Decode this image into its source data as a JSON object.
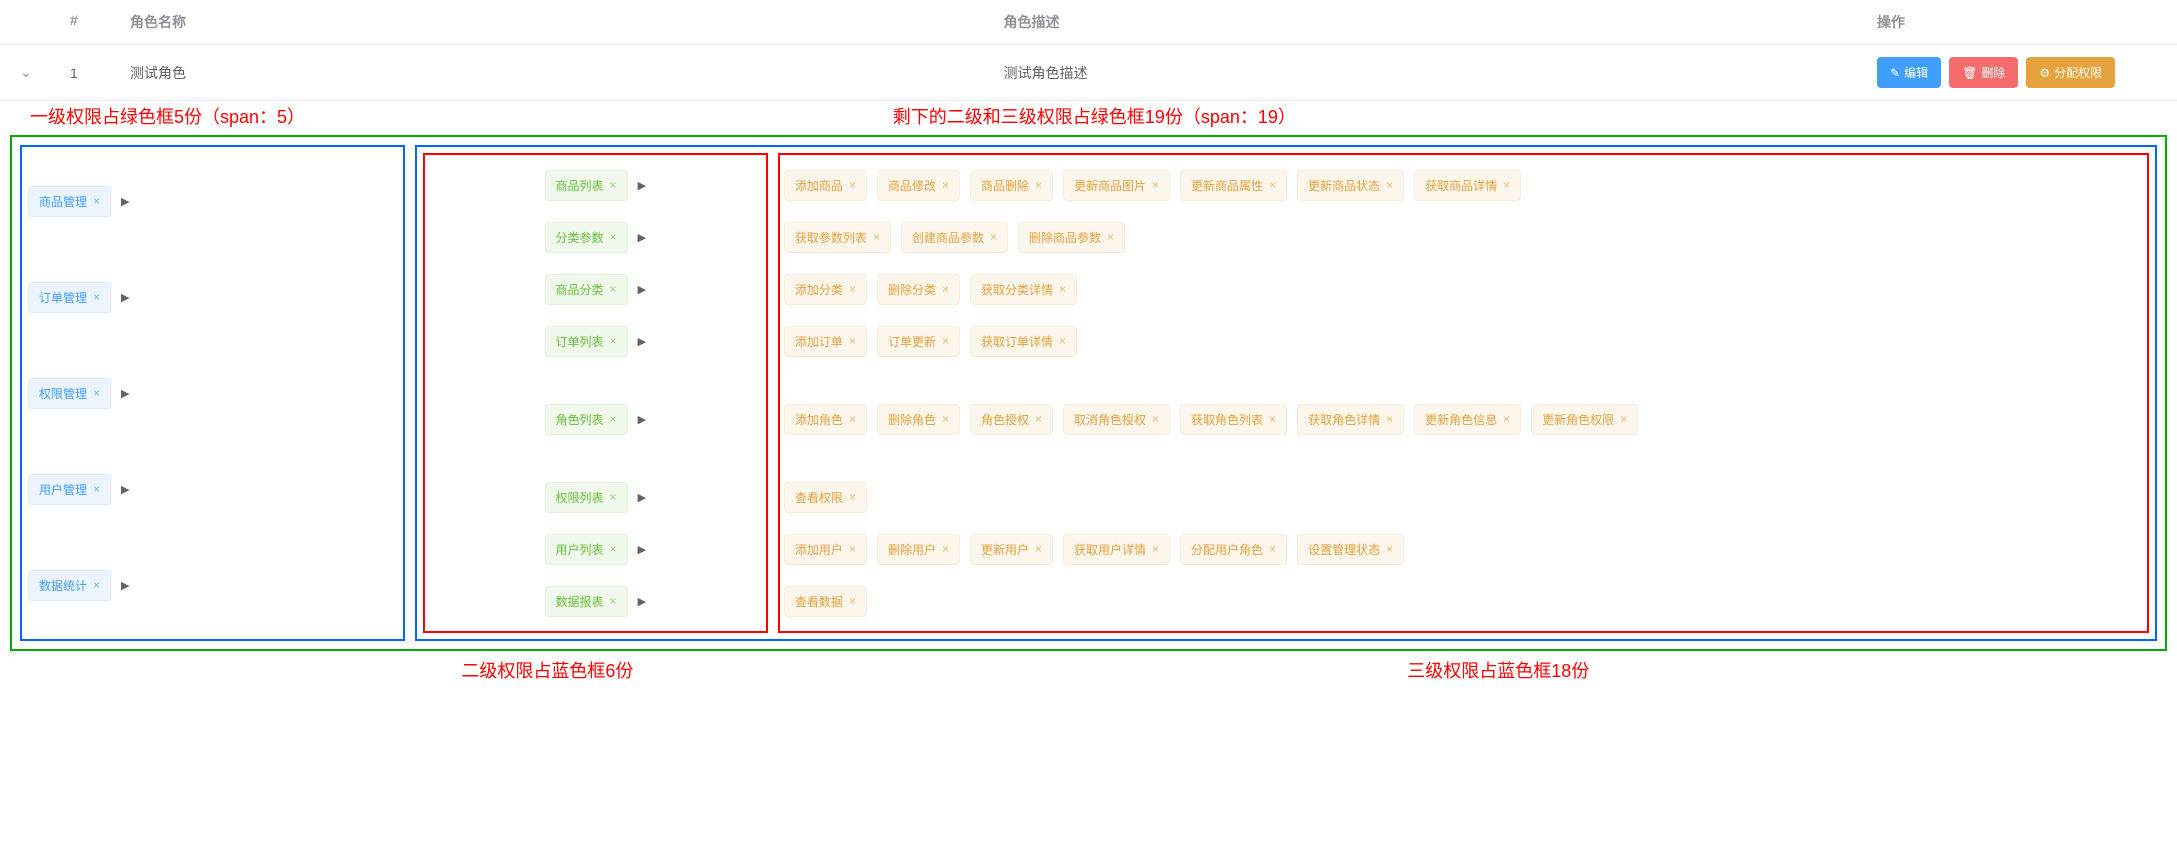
{
  "table": {
    "headers": {
      "index": "#",
      "name": "角色名称",
      "desc": "角色描述",
      "actions": "操作"
    },
    "row": {
      "index": "1",
      "name": "测试角色",
      "desc": "测试角色描述"
    },
    "buttons": {
      "edit": "编辑",
      "delete": "删除",
      "assign": "分配权限"
    }
  },
  "annotations": {
    "top_left": "一级权限占绿色框5份（span：5）",
    "top_right": "剩下的二级和三级权限占绿色框19份（span：19）",
    "bottom_mid": "二级权限占蓝色框6份",
    "bottom_right": "三级权限占蓝色框18份"
  },
  "level1": [
    {
      "label": "商品管理"
    },
    {
      "label": "订单管理"
    },
    {
      "label": "权限管理"
    },
    {
      "label": "用户管理"
    },
    {
      "label": "数据统计"
    }
  ],
  "level2": [
    {
      "label": "商品列表",
      "l3": [
        "添加商品",
        "商品修改",
        "商品删除",
        "更新商品图片",
        "更新商品属性",
        "更新商品状态",
        "获取商品详情"
      ]
    },
    {
      "label": "分类参数",
      "l3": [
        "获取参数列表",
        "创建商品参数",
        "删除商品参数"
      ]
    },
    {
      "label": "商品分类",
      "l3": [
        "添加分类",
        "删除分类",
        "获取分类详情"
      ]
    },
    {
      "label": "订单列表",
      "l3": [
        "添加订单",
        "订单更新",
        "获取订单详情"
      ]
    },
    {
      "label": "角色列表",
      "l3": [
        "添加角色",
        "删除角色",
        "角色授权",
        "取消角色授权",
        "获取角色列表",
        "获取角色详情",
        "更新角色信息",
        "更新角色权限"
      ]
    },
    {
      "label": "权限列表",
      "l3": [
        "查看权限"
      ]
    },
    {
      "label": "用户列表",
      "l3": [
        "添加用户",
        "删除用户",
        "更新用户",
        "获取用户详情",
        "分配用户角色",
        "设置管理状态"
      ]
    },
    {
      "label": "数据报表",
      "l3": [
        "查看数据"
      ]
    }
  ]
}
